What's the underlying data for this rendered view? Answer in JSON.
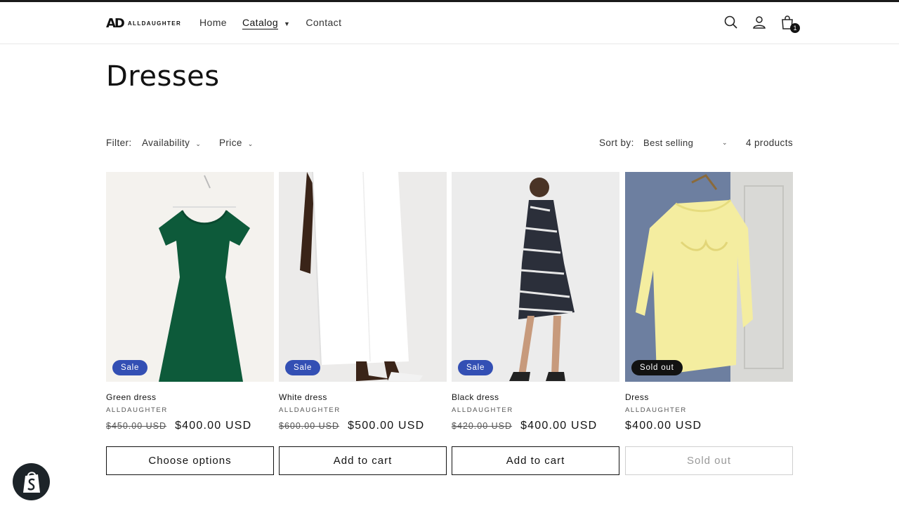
{
  "header": {
    "logo_mark": "AD",
    "logo_text": "ALLDAUGHTER",
    "nav": [
      {
        "label": "Home"
      },
      {
        "label": "Catalog"
      },
      {
        "label": "Contact"
      }
    ],
    "cart_count": "1"
  },
  "page": {
    "title": "Dresses"
  },
  "filters": {
    "label": "Filter:",
    "availability": "Availability",
    "price": "Price",
    "sort_label": "Sort by:",
    "sort_value": "Best selling",
    "count": "4 products"
  },
  "products": [
    {
      "title": "Green dress",
      "vendor": "ALLDAUGHTER",
      "badge": "Sale",
      "old_price": "$450.00 USD",
      "price": "$400.00 USD",
      "button": "Choose options",
      "image": "green-dress"
    },
    {
      "title": "White dress",
      "vendor": "ALLDAUGHTER",
      "badge": "Sale",
      "old_price": "$600.00 USD",
      "price": "$500.00 USD",
      "button": "Add to cart",
      "image": "white-dress"
    },
    {
      "title": "Black dress",
      "vendor": "ALLDAUGHTER",
      "badge": "Sale",
      "old_price": "$420.00 USD",
      "price": "$400.00 USD",
      "button": "Add to cart",
      "image": "black-dress"
    },
    {
      "title": "Dress",
      "vendor": "ALLDAUGHTER",
      "badge": "Sold out",
      "old_price": "",
      "price": "$400.00 USD",
      "button": "Sold out",
      "image": "yellow-dress"
    }
  ],
  "colors": {
    "sale_badge": "#334fb4",
    "soldout_badge": "#121212",
    "text": "#121212"
  },
  "icons": [
    "search-icon",
    "account-icon",
    "cart-icon",
    "chevron-down-icon",
    "shopify-icon"
  ]
}
